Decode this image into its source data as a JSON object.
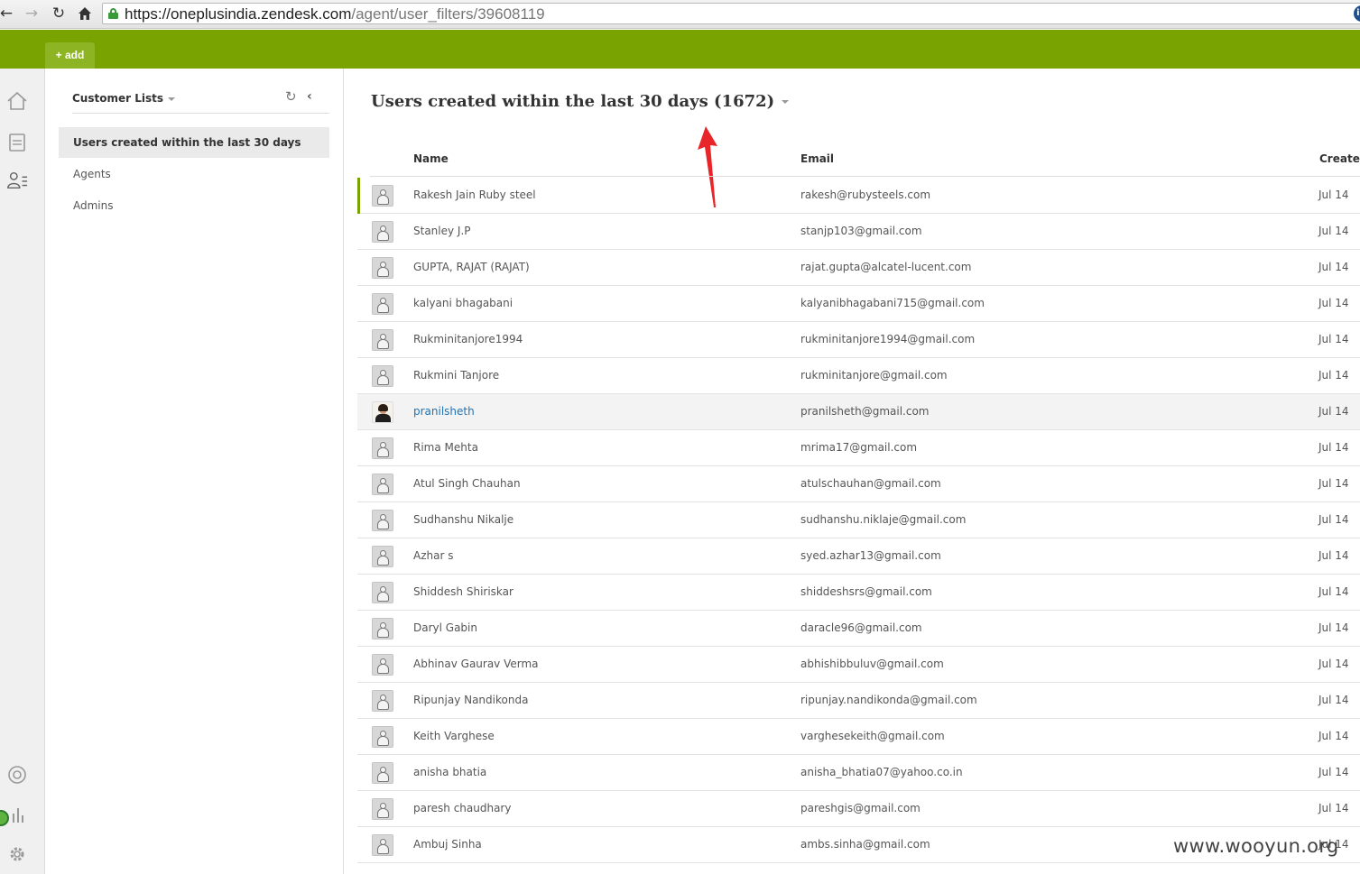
{
  "browser": {
    "url_host": "https://oneplusindia.zendesk.com",
    "url_path": "/agent/user_filters/39608119",
    "extension_label": "iG"
  },
  "topbar": {
    "add_label": "+ add"
  },
  "rail": {
    "icons": [
      "home-icon",
      "views-icon",
      "customer-lists-icon",
      "help-icon",
      "reporting-icon",
      "settings-icon"
    ]
  },
  "sidebar": {
    "title": "Customer Lists",
    "items": [
      {
        "label": "Users created within the last 30 days",
        "active": true
      },
      {
        "label": "Agents",
        "active": false
      },
      {
        "label": "Admins",
        "active": false
      }
    ]
  },
  "view": {
    "title": "Users created within the last 30 days (1672)"
  },
  "table": {
    "columns": [
      "Name",
      "Email",
      "Created"
    ],
    "rows": [
      {
        "name": "Rakesh Jain Ruby steel",
        "email": "rakesh@rubysteels.com",
        "created": "Jul 14"
      },
      {
        "name": "Stanley J.P",
        "email": "stanjp103@gmail.com",
        "created": "Jul 14"
      },
      {
        "name": "GUPTA, RAJAT (RAJAT)",
        "email": "rajat.gupta@alcatel-lucent.com",
        "created": "Jul 14"
      },
      {
        "name": "kalyani bhagabani",
        "email": "kalyanibhagabani715@gmail.com",
        "created": "Jul 14"
      },
      {
        "name": "Rukminitanjore1994",
        "email": "rukminitanjore1994@gmail.com",
        "created": "Jul 14"
      },
      {
        "name": "Rukmini Tanjore",
        "email": "rukminitanjore@gmail.com",
        "created": "Jul 14"
      },
      {
        "name": "pranilsheth",
        "email": "pranilsheth@gmail.com",
        "created": "Jul 14"
      },
      {
        "name": "Rima Mehta",
        "email": "mrima17@gmail.com",
        "created": "Jul 14"
      },
      {
        "name": "Atul Singh Chauhan",
        "email": "atulschauhan@gmail.com",
        "created": "Jul 14"
      },
      {
        "name": "Sudhanshu Nikalje",
        "email": "sudhanshu.niklaje@gmail.com",
        "created": "Jul 14"
      },
      {
        "name": "Azhar s",
        "email": "syed.azhar13@gmail.com",
        "created": "Jul 14"
      },
      {
        "name": "Shiddesh Shiriskar",
        "email": "shiddeshsrs@gmail.com",
        "created": "Jul 14"
      },
      {
        "name": "Daryl Gabin",
        "email": "daracle96@gmail.com",
        "created": "Jul 14"
      },
      {
        "name": "Abhinav Gaurav Verma",
        "email": "abhishibbuluv@gmail.com",
        "created": "Jul 14"
      },
      {
        "name": "Ripunjay Nandikonda",
        "email": "ripunjay.nandikonda@gmail.com",
        "created": "Jul 14"
      },
      {
        "name": "Keith Varghese",
        "email": "varghesekeith@gmail.com",
        "created": "Jul 14"
      },
      {
        "name": "anisha bhatia",
        "email": "anisha_bhatia07@yahoo.co.in",
        "created": "Jul 14"
      },
      {
        "name": "paresh chaudhary",
        "email": "pareshgis@gmail.com",
        "created": "Jul 14"
      },
      {
        "name": "Ambuj Sinha",
        "email": "ambs.sinha@gmail.com",
        "created": "Jul 14"
      }
    ]
  },
  "watermark": "www.wooyun.org",
  "colors": {
    "brand_green": "#78a300",
    "link_blue": "#1f73b7",
    "annotation_red": "#e8262a"
  }
}
